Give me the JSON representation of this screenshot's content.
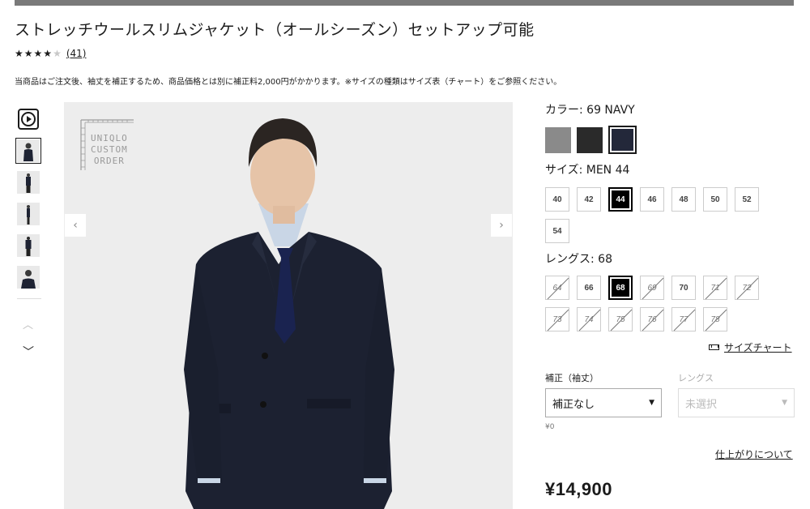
{
  "product": {
    "title": "ストレッチウールスリムジャケット（オールシーズン）セットアップ可能",
    "rating": {
      "stars_filled": 4,
      "stars_total": 5,
      "review_count": "(41)"
    },
    "notice": "当商品はご注文後、袖丈を補正するため、商品価格とは別に補正料2,000円がかかります。※サイズの種類はサイズ表（チャート）をご参照ください。",
    "image_logo": {
      "line1": "UNIQLO",
      "line2": "CUSTOM",
      "line3": "ORDER"
    },
    "nav": {
      "prev": "‹",
      "next": "›"
    }
  },
  "color": {
    "label": "カラー: 69 NAVY",
    "swatches": [
      {
        "name": "gray",
        "hex": "#8a8a8a",
        "selected": false
      },
      {
        "name": "black",
        "hex": "#2a2a2a",
        "selected": false
      },
      {
        "name": "navy",
        "hex": "#23283a",
        "selected": true
      }
    ]
  },
  "size": {
    "label": "サイズ: MEN 44",
    "options": [
      {
        "v": "40",
        "sel": false
      },
      {
        "v": "42",
        "sel": false
      },
      {
        "v": "44",
        "sel": true
      },
      {
        "v": "46",
        "sel": false
      },
      {
        "v": "48",
        "sel": false
      },
      {
        "v": "50",
        "sel": false
      },
      {
        "v": "52",
        "sel": false
      },
      {
        "v": "54",
        "sel": false
      }
    ]
  },
  "length": {
    "label": "レングス: 68",
    "options": [
      {
        "v": "64",
        "sel": false,
        "na": true
      },
      {
        "v": "66",
        "sel": false,
        "na": false
      },
      {
        "v": "68",
        "sel": true,
        "na": false
      },
      {
        "v": "69",
        "sel": false,
        "na": true
      },
      {
        "v": "70",
        "sel": false,
        "na": false
      },
      {
        "v": "71",
        "sel": false,
        "na": true
      },
      {
        "v": "72",
        "sel": false,
        "na": true
      },
      {
        "v": "73",
        "sel": false,
        "na": true
      },
      {
        "v": "74",
        "sel": false,
        "na": true
      },
      {
        "v": "75",
        "sel": false,
        "na": true
      },
      {
        "v": "76",
        "sel": false,
        "na": true
      },
      {
        "v": "77",
        "sel": false,
        "na": true
      },
      {
        "v": "78",
        "sel": false,
        "na": true
      }
    ]
  },
  "size_chart_link": "サイズチャート",
  "alteration": {
    "sleeve_label": "補正（袖丈）",
    "sleeve_value": "補正なし",
    "length_label": "レングス",
    "length_value": "未選択",
    "fee": "¥0"
  },
  "finish_link": "仕上がりについて",
  "price": "¥14,900"
}
